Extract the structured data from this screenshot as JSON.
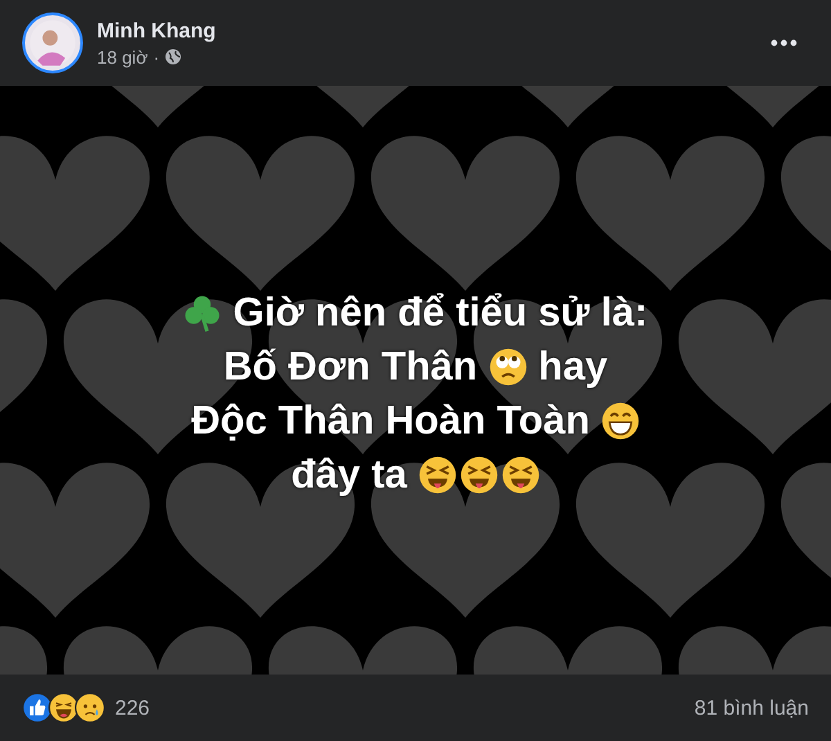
{
  "post": {
    "author": "Minh Khang",
    "time": "18 giờ",
    "separator": "·"
  },
  "content": {
    "kind": "hearts",
    "lines": [
      [
        {
          "kind": "clover"
        },
        {
          "kind": "text",
          "text": "Giờ nên để tiểu sử là:"
        }
      ],
      [
        {
          "kind": "text",
          "text": "Bố Đơn Thân"
        },
        {
          "kind": "eyeroll"
        },
        {
          "kind": "text",
          "text": "hay"
        }
      ],
      [
        {
          "kind": "text",
          "text": "Độc Thân Hoàn Toàn"
        },
        {
          "kind": "grin"
        }
      ],
      [
        {
          "kind": "text",
          "text": "đây ta"
        },
        {
          "kind": "squint"
        },
        {
          "kind": "squint"
        },
        {
          "kind": "squint"
        }
      ]
    ]
  },
  "footer": {
    "reactions": [
      {
        "kind": "like"
      },
      {
        "kind": "haha"
      },
      {
        "kind": "sad"
      }
    ],
    "reaction_count": "226",
    "comments": "81 bình luận"
  }
}
